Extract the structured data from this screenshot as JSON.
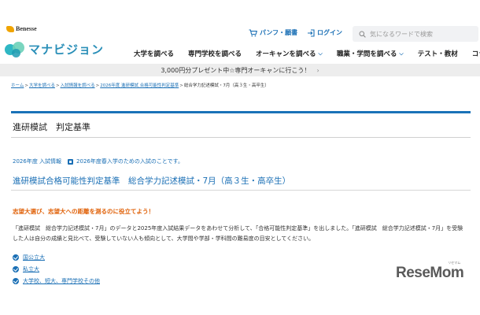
{
  "brand": {
    "company": "Benesse",
    "site_name": "マナビジョン"
  },
  "header": {
    "util_links": [
      {
        "label": "パンフ・願書",
        "icon": "cart-icon"
      },
      {
        "label": "ログイン",
        "icon": "login-icon"
      }
    ],
    "search": {
      "placeholder": "気になるワードで検索",
      "icon": "search-icon"
    }
  },
  "gnav": {
    "items": [
      {
        "label": "大学を調べる",
        "has_menu": false
      },
      {
        "label": "専門学校を調べる",
        "has_menu": false
      },
      {
        "label": "オーキャンを調べる",
        "has_menu": true
      },
      {
        "label": "職業・学問を調べる",
        "has_menu": true
      },
      {
        "label": "テスト・教材",
        "has_menu": false
      },
      {
        "label": "コラム",
        "has_menu": false
      }
    ]
  },
  "banner": {
    "text": "3,000円分プレゼント中☆専門オーキャンに行こう！",
    "arrow": "›"
  },
  "breadcrumb": {
    "items": [
      {
        "label": "ホーム",
        "link": true
      },
      {
        "label": "大学を調べる",
        "link": true
      },
      {
        "label": "入試情報を調べる",
        "link": true
      },
      {
        "label": "2026年度 進研模試 合格可能性判定基準",
        "link": true
      },
      {
        "label": "総合学力記述模試・7月（高３生・高卒生）",
        "link": false
      }
    ],
    "separator": ">"
  },
  "page": {
    "title": "進研模試　判定基準",
    "year_label": "2026年度 入試情報",
    "note": "2026年度春入学のための入試のことです。",
    "subtitle": "進研模試合格可能性判定基準　総合学力記述模試・7月（高３生・高卒生）",
    "lead": "志望大選び、志望大への距離を測るのに役立てよう！",
    "body": "「進研模試　総合学力記述模試・7月」のデータと2025年度入試結果データをあわせて分析して、「合格可能性判定基準」を出しました。「進研模試　総合学力記述模試・7月」を受験した人は自分の成績と見比べて、受験していない人も傾向として、大学間や学部・学科間の難易度の目安としてください。",
    "links": [
      "国公立大",
      "私立大",
      "大学校、短大、専門学校その他"
    ]
  },
  "watermark": {
    "text": "ReseMom",
    "ruby": "リセマム"
  },
  "colors": {
    "accent": "#1a6fb5",
    "lead": "#e0620a",
    "rule": "#1a72b8",
    "banner_bg": "#ededed"
  }
}
